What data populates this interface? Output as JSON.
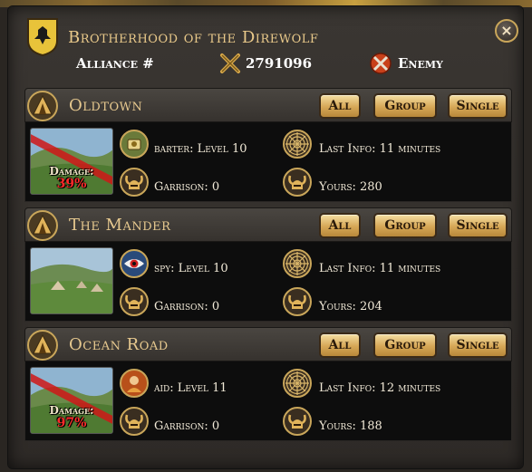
{
  "header": {
    "title": "Brotherhood of the Direwolf",
    "alliance_label": "Alliance #",
    "alliance_number": "2791096",
    "stance": "Enemy",
    "close_label": "×"
  },
  "filter_buttons": {
    "all": "All",
    "group": "Group",
    "single": "Single"
  },
  "locations": [
    {
      "name": "Oldtown",
      "damaged": true,
      "damage_label": "Damage:",
      "damage_value": "39%",
      "agent_icon": "barter-icon",
      "agent_text": "barter: Level 10",
      "last_info": "Last Info: 11 minutes",
      "garrison": "Garrison: 0",
      "yours": "Yours: 280"
    },
    {
      "name": "The Mander",
      "damaged": false,
      "agent_icon": "spy-eye-icon",
      "agent_text": "spy: Level 10",
      "last_info": "Last Info: 11 minutes",
      "garrison": "Garrison: 0",
      "yours": "Yours: 204"
    },
    {
      "name": "Ocean Road",
      "damaged": true,
      "damage_label": "Damage:",
      "damage_value": "97%",
      "agent_icon": "aid-icon",
      "agent_text": "aid: Level 11",
      "last_info": "Last Info: 12 minutes",
      "garrison": "Garrison: 0",
      "yours": "Yours: 188"
    }
  ],
  "colors": {
    "gold_text": "#e7c98f",
    "button_gold": "#d6a756",
    "damage_red": "#ff2a2a",
    "panel": "#2e2a27",
    "card_body": "#0d0d0d"
  }
}
